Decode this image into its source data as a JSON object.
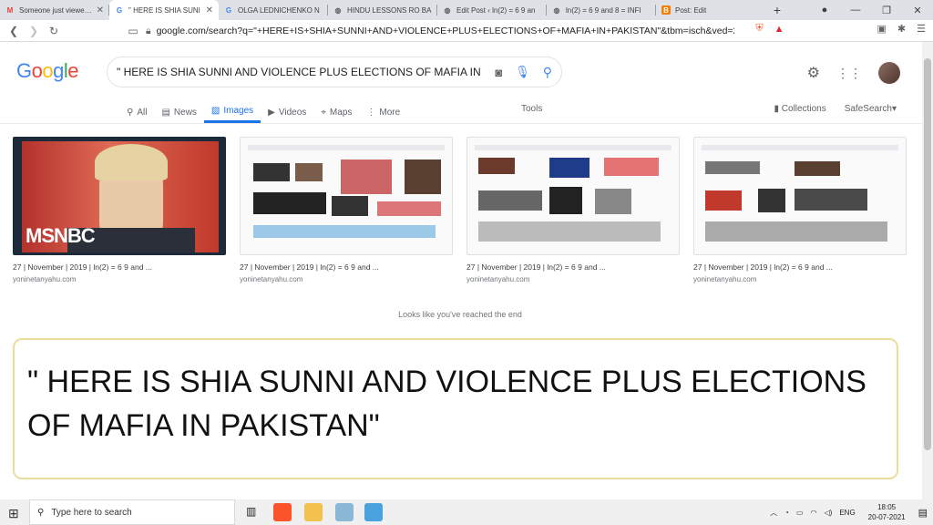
{
  "browser": {
    "tabs": [
      {
        "title": "Someone just viewed: F",
        "favicon": "gmail-icon"
      },
      {
        "title": "\" HERE IS SHIA SUNI",
        "favicon": "google-icon",
        "active": true
      },
      {
        "title": "OLGA LEDNICHENKO N",
        "favicon": "google-icon"
      },
      {
        "title": "HINDU LESSONS RO BA",
        "favicon": "globe-icon"
      },
      {
        "title": "Edit Post ‹ ln(2) = 6 9 an",
        "favicon": "globe-icon"
      },
      {
        "title": "ln(2) = 6 9 and 8 = INFI",
        "favicon": "globe-icon"
      },
      {
        "title": "Post: Edit",
        "favicon": "blogger-icon"
      }
    ],
    "new_tab": "+",
    "url": "google.com/search?q=\"+HERE+IS+SHIA+SUNNI+AND+VIOLENCE+PLUS+ELECTIONS+OF+MAFIA+IN+PAKISTAN\"&tbm=isch&ved=2a..."
  },
  "google": {
    "logo": "Google",
    "query": "\" HERE IS SHIA SUNNI AND VIOLENCE PLUS ELECTIONS OF MAFIA IN",
    "nav": {
      "all": "All",
      "news": "News",
      "images": "Images",
      "videos": "Videos",
      "maps": "Maps",
      "more": "More",
      "tools": "Tools",
      "collections": "Collections",
      "safesearch": "SafeSearch"
    },
    "results": [
      {
        "caption": "27 | November | 2019 | ln(2) = 6 9 and ...",
        "site": "yoninetanyahu.com",
        "overlay": "MSNBC"
      },
      {
        "caption": "27 | November | 2019 | ln(2) = 6 9 and ...",
        "site": "yoninetanyahu.com"
      },
      {
        "caption": "27 | November | 2019 | ln(2) = 6 9 and ...",
        "site": "yoninetanyahu.com"
      },
      {
        "caption": "27 | November | 2019 | ln(2) = 6 9 and ...",
        "site": "yoninetanyahu.com"
      }
    ],
    "end_message": "Looks like you've reached the end"
  },
  "overlay_text": "\" HERE IS SHIA SUNNI AND VIOLENCE PLUS ELECTIONS OF MAFIA IN PAKISTAN\"",
  "taskbar": {
    "search_placeholder": "Type here to search",
    "lang": "ENG",
    "time": "18:05",
    "date": "20-07-2021"
  },
  "colors": {
    "accent": "#1a73e8",
    "box_border": "#e8dd9d",
    "msnbc_bg": "#c0392b"
  }
}
